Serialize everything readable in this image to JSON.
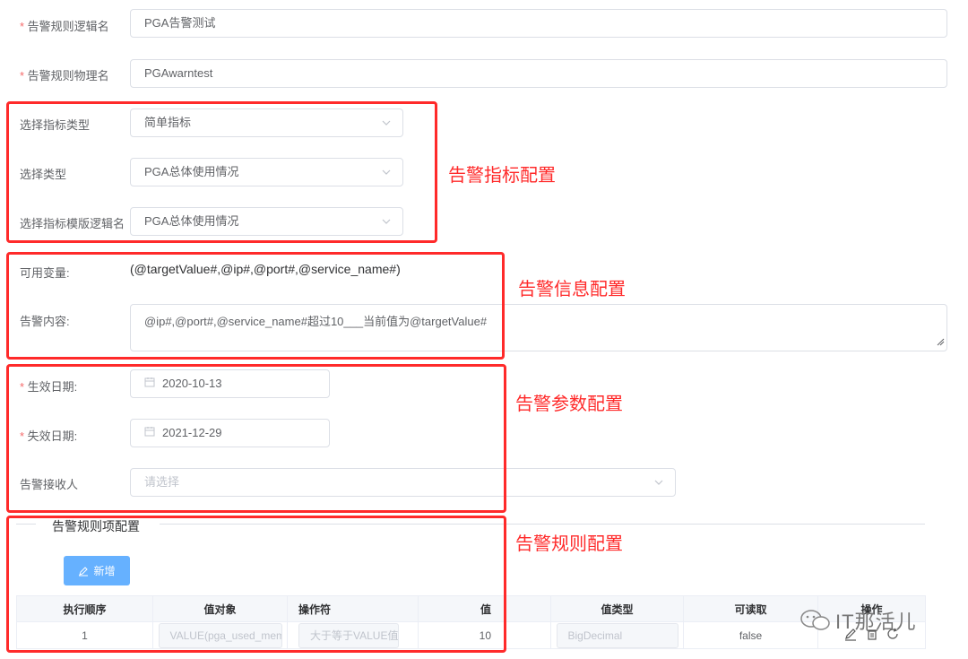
{
  "form": {
    "logic_name": {
      "label": "告警规则逻辑名",
      "value": "PGA告警测试"
    },
    "physical_name": {
      "label": "告警规则物理名",
      "value": "PGAwarntest"
    },
    "indicator_type": {
      "label": "选择指标类型",
      "value": "简单指标"
    },
    "type": {
      "label": "选择类型",
      "value": "PGA总体使用情况"
    },
    "template_name": {
      "label": "选择指标模版逻辑名",
      "value": "PGA总体使用情况"
    },
    "variables": {
      "label": "可用变量:",
      "value": "(@targetValue#,@ip#,@port#,@service_name#)"
    },
    "content": {
      "label": "告警内容:",
      "value": "@ip#,@port#,@service_name#超过10___当前值为@targetValue#"
    },
    "effective_date": {
      "label": "生效日期:",
      "value": "2020-10-13"
    },
    "expire_date": {
      "label": "失效日期:",
      "value": "2021-12-29"
    },
    "receiver": {
      "label": "告警接收人",
      "placeholder": "请选择"
    }
  },
  "section": {
    "title": "告警规则项配置",
    "add_button": "新增"
  },
  "table": {
    "headers": [
      "执行顺序",
      "值对象",
      "操作符",
      "值",
      "值类型",
      "可读取",
      "操作"
    ],
    "rows": [
      {
        "order": "1",
        "value_object": "VALUE(pga_used_mem",
        "operator": "大于等于VALUE值",
        "value": "10",
        "value_type": "BigDecimal",
        "readable": "false"
      }
    ]
  },
  "annotations": {
    "indicator": "告警指标配置",
    "info": "告警信息配置",
    "params": "告警参数配置",
    "rules": "告警规则配置"
  },
  "watermark": "IT那活儿",
  "colors": {
    "annotation": "#ff2a2a",
    "required": "#f56c6c",
    "button": "#66b1ff"
  }
}
